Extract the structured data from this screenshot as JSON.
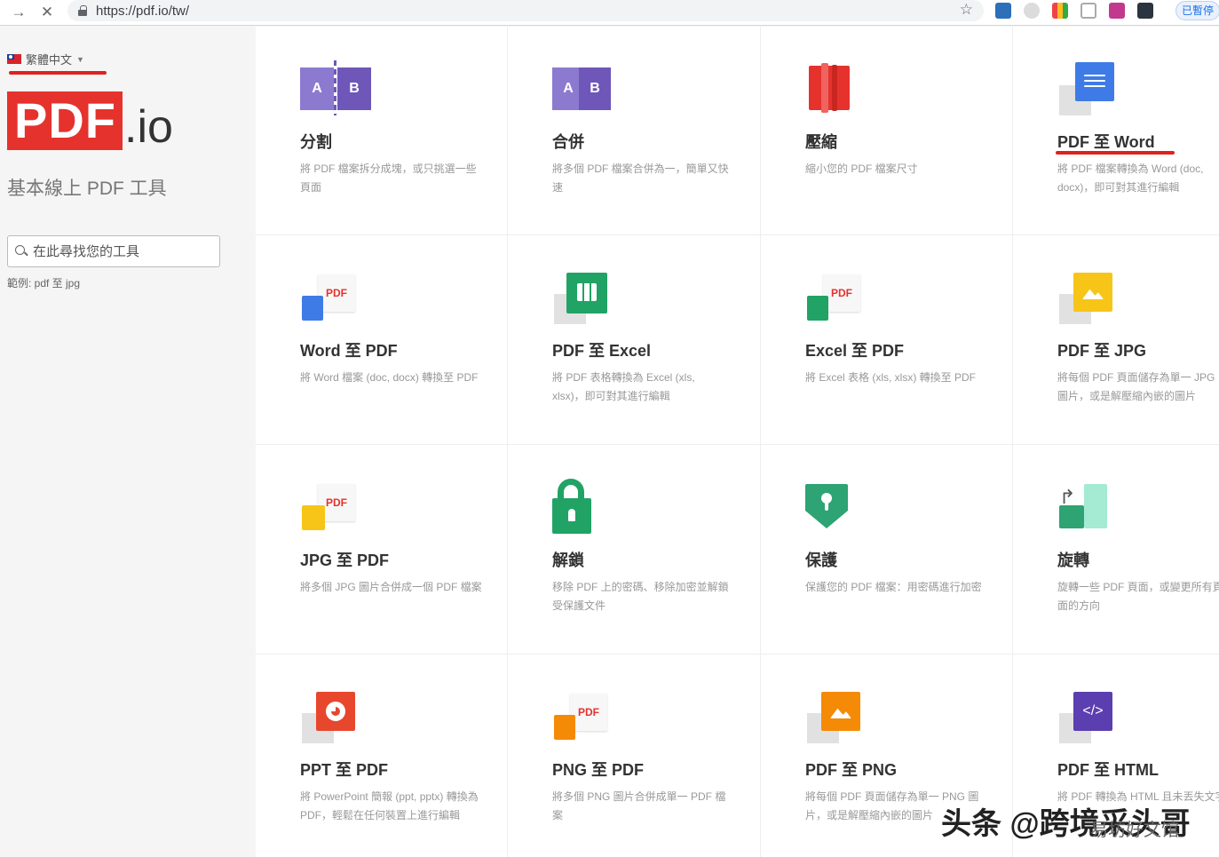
{
  "browser": {
    "url": "https://pdf.io/tw/",
    "back_icon": "→",
    "stop_icon": "✕",
    "star_icon": "☆",
    "paused_label": "已暫停"
  },
  "sidebar": {
    "language": "繁體中文",
    "logo_pdf": "PDF",
    "logo_io": ".io",
    "tagline": "基本線上 PDF 工具",
    "search_placeholder": "在此尋找您的工具",
    "example": "範例: pdf 至 jpg"
  },
  "tools": [
    {
      "title": "分割",
      "desc": "將 PDF 檔案拆分成塊，或只挑選一些頁面",
      "icon": "split-icon"
    },
    {
      "title": "合併",
      "desc": "將多個 PDF 檔案合併為一，簡單又快速",
      "icon": "merge-icon"
    },
    {
      "title": "壓縮",
      "desc": "縮小您的 PDF 檔案尺寸",
      "icon": "compress-icon"
    },
    {
      "title": "PDF 至 Word",
      "desc": "將 PDF 檔案轉換為 Word (doc, docx)，即可對其進行編輯",
      "icon": "pdf-to-word-icon"
    },
    {
      "title": "Word 至 PDF",
      "desc": "將 Word 檔案 (doc, docx) 轉換至 PDF",
      "icon": "word-to-pdf-icon"
    },
    {
      "title": "PDF 至 Excel",
      "desc": "將 PDF 表格轉換為 Excel (xls, xlsx)，即可對其進行編輯",
      "icon": "pdf-to-excel-icon"
    },
    {
      "title": "Excel 至 PDF",
      "desc": "將 Excel 表格 (xls, xlsx) 轉換至 PDF",
      "icon": "excel-to-pdf-icon"
    },
    {
      "title": "PDF 至 JPG",
      "desc": "將每個 PDF 頁面儲存為單一 JPG 圖片，或是解壓縮內嵌的圖片",
      "icon": "pdf-to-jpg-icon"
    },
    {
      "title": "JPG 至 PDF",
      "desc": "將多個 JPG 圖片合併成一個 PDF 檔案",
      "icon": "jpg-to-pdf-icon"
    },
    {
      "title": "解鎖",
      "desc": "移除 PDF 上的密碼、移除加密並解鎖受保護文件",
      "icon": "unlock-icon"
    },
    {
      "title": "保護",
      "desc": "保護您的 PDF 檔案：用密碼進行加密",
      "icon": "protect-icon"
    },
    {
      "title": "旋轉",
      "desc": "旋轉一些 PDF 頁面，或變更所有頁面的方向",
      "icon": "rotate-icon"
    },
    {
      "title": "PPT 至 PDF",
      "desc": "將 PowerPoint 簡報 (ppt, pptx) 轉換為 PDF，輕鬆在任何裝置上進行編輯",
      "icon": "ppt-to-pdf-icon"
    },
    {
      "title": "PNG 至 PDF",
      "desc": "將多個 PNG 圖片合併成單一 PDF 檔案",
      "icon": "png-to-pdf-icon"
    },
    {
      "title": "PDF 至 PNG",
      "desc": "將每個 PDF 頁面儲存為單一 PNG 圖片，或是解壓縮內嵌的圖片",
      "icon": "pdf-to-png-icon"
    },
    {
      "title": "PDF 至 HTML",
      "desc": "將 PDF 轉換為 HTML 且未丟失文字",
      "icon": "pdf-to-html-icon"
    }
  ],
  "icon_labels": {
    "a": "A",
    "b": "B",
    "pdf": "PDF",
    "code": "</>"
  },
  "watermark": {
    "main": "头条 @跨境采头哥",
    "sub": "易坊好文馆"
  },
  "colors": {
    "brand_red": "#e5322d",
    "word_blue": "#3f7be6",
    "excel_green": "#21a366",
    "jpg_yellow": "#f7c518",
    "ppt_red": "#e7472d",
    "png_orange": "#f58a07",
    "html_purple": "#5b3eb0",
    "protect_green": "#2ea374"
  }
}
